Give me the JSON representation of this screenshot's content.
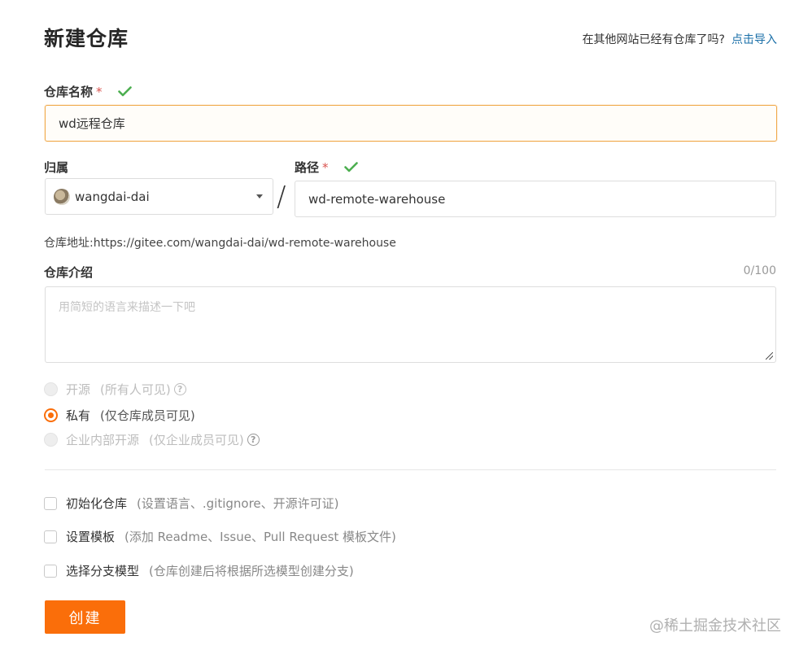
{
  "page": {
    "title": "新建仓库",
    "import_prompt": "在其他网站已经有仓库了吗?",
    "import_link": "点击导入"
  },
  "repo_name": {
    "label": "仓库名称",
    "required_mark": "*",
    "value": "wd远程仓库"
  },
  "owner": {
    "label": "归属",
    "value": "wangdai-dai"
  },
  "separator": "/",
  "path": {
    "label": "路径",
    "required_mark": "*",
    "value": "wd-remote-warehouse"
  },
  "address": {
    "text": "仓库地址:https://gitee.com/wangdai-dai/wd-remote-warehouse"
  },
  "description": {
    "label": "仓库介绍",
    "counter": "0/100",
    "placeholder": "用简短的语言来描述一下吧"
  },
  "visibility": {
    "options": [
      {
        "label": "开源",
        "sub": "(所有人可见)",
        "state": "disabled",
        "help": "?"
      },
      {
        "label": "私有",
        "sub": "(仅仓库成员可见)",
        "state": "checked"
      },
      {
        "label": "企业内部开源",
        "sub": "(仅企业成员可见)",
        "state": "disabled",
        "help": "?"
      }
    ]
  },
  "options": [
    {
      "label": "初始化仓库",
      "sub": "(设置语言、.gitignore、开源许可证)",
      "checked": false
    },
    {
      "label": "设置模板",
      "sub": "(添加 Readme、Issue、Pull Request 模板文件)",
      "checked": false
    },
    {
      "label": "选择分支模型",
      "sub": "(仓库创建后将根据所选模型创建分支)",
      "checked": false
    }
  ],
  "create_button": "创建",
  "watermark": "@稀土掘金技术社区",
  "colors": {
    "accent": "#fa6e0a",
    "link": "#1a6fa8",
    "valid_check": "#4caf50",
    "required": "#d9534f",
    "focus_border": "#f0a94a"
  }
}
